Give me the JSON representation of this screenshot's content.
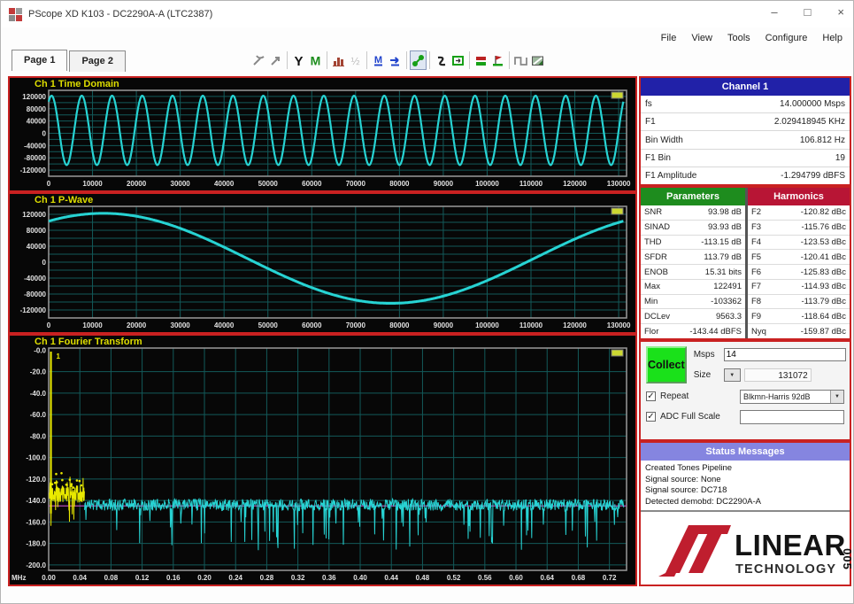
{
  "window": {
    "title": "PScope XD K103 - DC2290A-A (LTC2387)",
    "controls": {
      "minimize": "–",
      "maximize": "□",
      "close": "×"
    }
  },
  "menu": {
    "items": [
      "File",
      "View",
      "Tools",
      "Configure",
      "Help"
    ]
  },
  "tabs": [
    {
      "label": "Page 1"
    },
    {
      "label": "Page 2"
    }
  ],
  "toolbar": {
    "icons": [
      "cursor-tools",
      "zoom-arrow",
      "y-axis-tool",
      "histogram-tool",
      "bar-graph-tool",
      "half-scale-tool",
      "max-min-tool",
      "average-tool",
      "node-link-tool",
      "phase-tool",
      "window-select-tool",
      "collect-config-tool",
      "flag-tool",
      "square-wave-tool",
      "screenshot-tool"
    ]
  },
  "channel_panel": {
    "title": "Channel 1",
    "rows": [
      {
        "label": "fs",
        "value": "14.000000 Msps"
      },
      {
        "label": "F1",
        "value": "2.029418945 KHz"
      },
      {
        "label": "Bin Width",
        "value": "106.812 Hz"
      },
      {
        "label": "F1 Bin",
        "value": "19"
      },
      {
        "label": "F1 Amplitude",
        "value": "-1.294799 dBFS"
      }
    ]
  },
  "parameters": {
    "title": "Parameters",
    "rows": [
      {
        "label": "SNR",
        "value": "93.98 dB"
      },
      {
        "label": "SINAD",
        "value": "93.93 dB"
      },
      {
        "label": "THD",
        "value": "-113.15 dB"
      },
      {
        "label": "SFDR",
        "value": "113.79 dB"
      },
      {
        "label": "ENOB",
        "value": "15.31 bits"
      },
      {
        "label": "Max",
        "value": "122491"
      },
      {
        "label": "Min",
        "value": "-103362"
      },
      {
        "label": "DCLev",
        "value": "9563.3"
      },
      {
        "label": "Flor",
        "value": "-143.44 dBFS"
      }
    ]
  },
  "harmonics": {
    "title": "Harmonics",
    "rows": [
      {
        "label": "F2",
        "value": "-120.82 dBc"
      },
      {
        "label": "F3",
        "value": "-115.76 dBc"
      },
      {
        "label": "F4",
        "value": "-123.53 dBc"
      },
      {
        "label": "F5",
        "value": "-120.41 dBc"
      },
      {
        "label": "F6",
        "value": "-125.83 dBc"
      },
      {
        "label": "F7",
        "value": "-114.93 dBc"
      },
      {
        "label": "F8",
        "value": "-113.79 dBc"
      },
      {
        "label": "F9",
        "value": "-118.64 dBc"
      },
      {
        "label": "Nyq",
        "value": "-159.87 dBc"
      }
    ]
  },
  "controls": {
    "collect_label": "Collect",
    "msps_label": "Msps",
    "msps_value": "14",
    "size_label": "Size",
    "size_value": "131072",
    "repeat_label": "Repeat",
    "repeat_checked": true,
    "window_value": "Blkmn-Harris 92dB",
    "adc_label": "ADC Full Scale",
    "adc_checked": true,
    "adc_value": "",
    "check_glyph": "✓",
    "dropdown_arrow": "▼"
  },
  "status": {
    "title": "Status Messages",
    "lines": [
      "Created Tones Pipeline",
      "Signal source: None",
      "Signal source: DC718",
      "Detected demobd: DC2290A-A"
    ]
  },
  "logo": {
    "line1": "LINEAR",
    "line2": "TECHNOLOGY"
  },
  "figure_number": "005",
  "colors": {
    "panel_border_red": "#c92121",
    "header_blue": "#2121a8",
    "header_green": "#1e8c1e",
    "header_crimson": "#b81535",
    "header_purple": "#8585e0",
    "collect_green": "#1ae11a",
    "trace_cyan": "#27d3d3",
    "trace_yellow": "#e8e800",
    "floor_magenta": "#b44cb4",
    "grid_teal": "#135a5a",
    "plot_title_yellow": "#dede00"
  },
  "chart_data": [
    {
      "id": "time-domain",
      "type": "line",
      "title": "Ch 1 Time Domain",
      "xlim": [
        0,
        131800
      ],
      "ylim": [
        -140000,
        140000
      ],
      "x_ticks": [
        0,
        10000,
        20000,
        30000,
        40000,
        50000,
        60000,
        70000,
        80000,
        90000,
        100000,
        110000,
        120000,
        130000
      ],
      "y_ticks": [
        120000,
        80000,
        40000,
        0,
        -40000,
        -80000,
        -120000
      ],
      "x_decimals": 0,
      "y_decimals": 0,
      "y_grid_step": 20000,
      "grid": true,
      "legend_chip": true,
      "series": [
        {
          "name": "Ch 1",
          "color": "#27d3d3",
          "shape": "sine",
          "cycles": 19,
          "n_samples": 131072,
          "amplitude": 112927,
          "dc_offset": 9563,
          "phase_cycle_frac": 0.0951,
          "max": 122491,
          "min": -103362
        }
      ]
    },
    {
      "id": "pwave",
      "type": "line",
      "title": "Ch 1 P-Wave",
      "xlim": [
        0,
        131800
      ],
      "ylim": [
        -140000,
        140000
      ],
      "x_ticks": [
        0,
        10000,
        20000,
        30000,
        40000,
        50000,
        60000,
        70000,
        80000,
        90000,
        100000,
        110000,
        120000,
        130000
      ],
      "y_ticks": [
        120000,
        80000,
        40000,
        0,
        -40000,
        -80000,
        -120000
      ],
      "x_decimals": 0,
      "y_decimals": 0,
      "y_grid_step": 20000,
      "grid": true,
      "legend_chip": true,
      "series": [
        {
          "name": "Ch 1",
          "color": "#27d3d3",
          "shape": "sine",
          "cycles": 1,
          "n_samples": 131072,
          "amplitude": 112927,
          "dc_offset": 9563,
          "phase_cycle_frac": 0.0951,
          "max": 122491,
          "min": -103362
        }
      ]
    },
    {
      "id": "fft",
      "type": "fft",
      "title": "Ch 1 Fourier Transform",
      "x_unit": "MHz",
      "xlim": [
        0,
        0.742
      ],
      "ylim": [
        -205,
        2
      ],
      "x_ticks": [
        0,
        0.04,
        0.08,
        0.12,
        0.16,
        0.2,
        0.24,
        0.28,
        0.32,
        0.36,
        0.4,
        0.44,
        0.48,
        0.52,
        0.56,
        0.6,
        0.64,
        0.68,
        0.72
      ],
      "y_ticks": [
        0,
        -20,
        -40,
        -60,
        -80,
        -100,
        -120,
        -140,
        -160,
        -180,
        -200
      ],
      "x_decimals": 2,
      "y_decimals": 1,
      "y_grid_step": 20,
      "grid": true,
      "legend_chip": true,
      "fundamental": {
        "x": 0.0029,
        "peak_db": -1.294799,
        "marker_label": "1",
        "color": "#f0f000"
      },
      "noise_floor_line": {
        "db": -145,
        "color": "#b44cb4"
      },
      "noise": {
        "yellow_end_x": 0.046,
        "yellow_base_db": -134,
        "cyan_base_db": -144,
        "yellow_color": "#e8e800",
        "cyan_color": "#27d3d3",
        "avg_floor_dbfs": -143.44
      }
    }
  ]
}
